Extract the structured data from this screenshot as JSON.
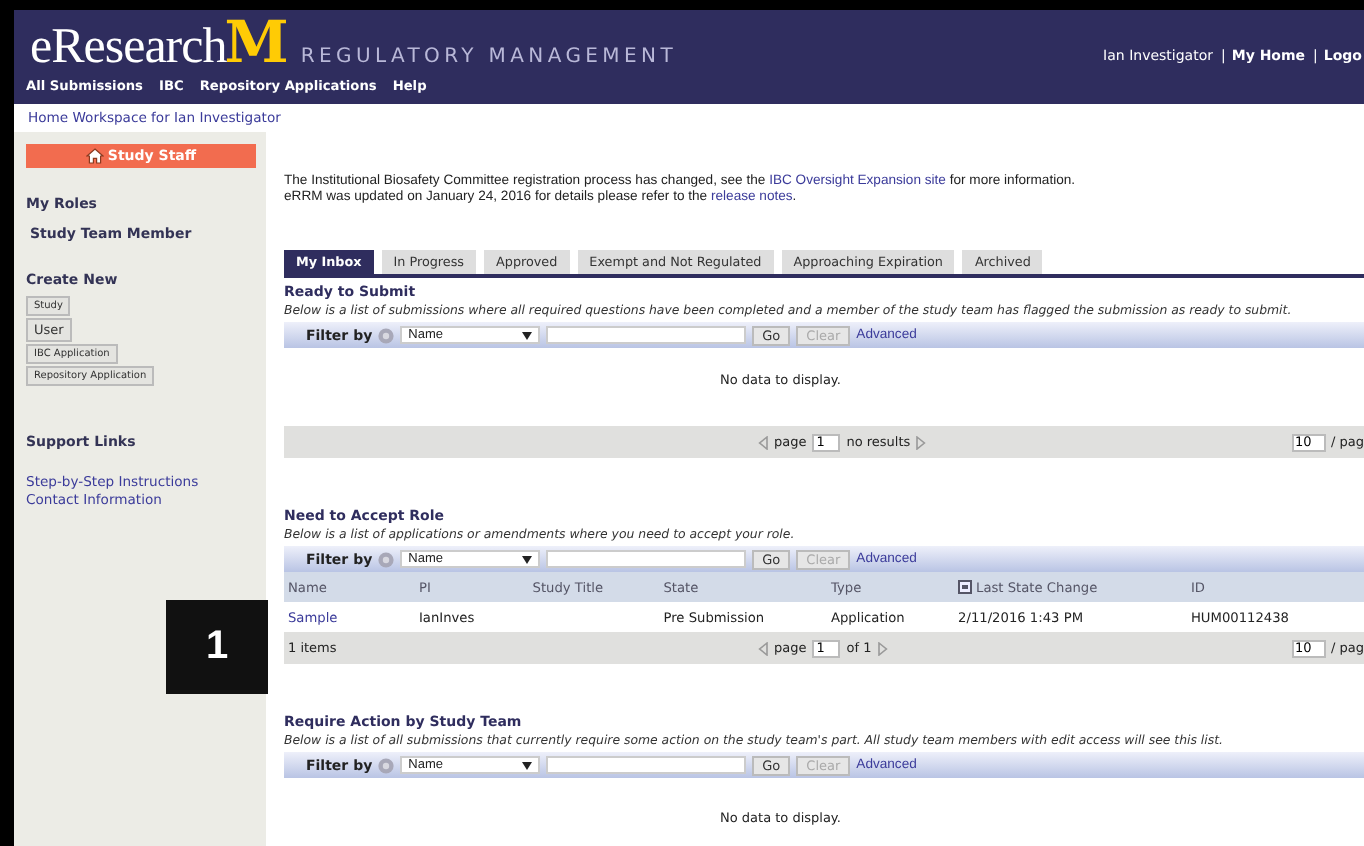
{
  "header": {
    "logo_text": "eResearch",
    "logo_mark": "M",
    "subtitle": "REGULATORY MANAGEMENT",
    "user": "Ian Investigator",
    "links": [
      {
        "separator": "|",
        "label": "My Home"
      },
      {
        "separator": "|",
        "label": "Logo"
      }
    ]
  },
  "nav": [
    "All Submissions",
    "IBC",
    "Repository Applications",
    "Help"
  ],
  "breadcrumb": "Home Workspace for Ian Investigator",
  "sidebar": {
    "staff_button": "Study Staff",
    "roles_title": "My Roles",
    "roles": [
      "Study Team Member"
    ],
    "create_title": "Create New",
    "create_buttons": [
      "Study",
      "User",
      "IBC Application",
      "Repository Application"
    ],
    "support_title": "Support Links",
    "support_links": [
      "Step-by-Step Instructions",
      "Contact Information"
    ]
  },
  "notice": [
    {
      "before": "The Institutional Biosafety Committee registration process has changed, see the ",
      "link": "IBC Oversight Expansion site",
      "after": " for more information."
    },
    {
      "before": "eRRM was updated on January 24, 2016 for details please refer to the ",
      "link": "release notes",
      "after": "."
    }
  ],
  "tabs": [
    {
      "label": "My Inbox",
      "selected": true
    },
    {
      "label": "In Progress",
      "selected": false
    },
    {
      "label": "Approved",
      "selected": false
    },
    {
      "label": "Exempt and Not Regulated",
      "selected": false
    },
    {
      "label": "Approaching Expiration",
      "selected": false
    },
    {
      "label": "Archived",
      "selected": false
    }
  ],
  "sections": [
    {
      "kind": "empty",
      "title": "Ready to Submit",
      "description": "Below is a list of submissions where all required questions have been completed and a member of the study team has flagged the submission as ready to submit.",
      "filter": {
        "label": "Filter by",
        "select": "Name",
        "go": "Go",
        "clear": "Clear",
        "clear_disabled": true,
        "advanced": "Advanced"
      },
      "no_data": "No data to display.",
      "pager": {
        "page_label": "page",
        "page": "1",
        "status": "no results",
        "per_page": "10",
        "per_page_label": "/ pag"
      }
    },
    {
      "kind": "table",
      "title": "Need to Accept Role",
      "description": "Below is a list of applications or amendments where you need to accept your role.",
      "filter": {
        "label": "Filter by",
        "select": "Name",
        "go": "Go",
        "clear": "Clear",
        "clear_disabled": true,
        "advanced": "Advanced"
      },
      "columns": [
        "Name",
        "PI",
        "Study Title",
        "State",
        "Type",
        "Last State Change",
        "ID"
      ],
      "rows": [
        [
          "Sample",
          "IanInves",
          "",
          "Pre Submission",
          "Application",
          "2/11/2016 1:43 PM",
          "HUM00112438"
        ]
      ],
      "items": "1 items",
      "pager": {
        "page_label": "page",
        "page": "1",
        "status": "of 1",
        "per_page": "10",
        "per_page_label": "/ pag"
      }
    },
    {
      "kind": "empty",
      "title": "Require Action by Study Team",
      "description": "Below is a list of all submissions that currently require some action on the study team's part. All study team members with edit access will see this list.",
      "filter": {
        "label": "Filter by",
        "select": "Name",
        "go": "Go",
        "clear": "Clear",
        "clear_disabled": true,
        "advanced": "Advanced"
      },
      "no_data": "No data to display."
    }
  ],
  "callout": "1"
}
